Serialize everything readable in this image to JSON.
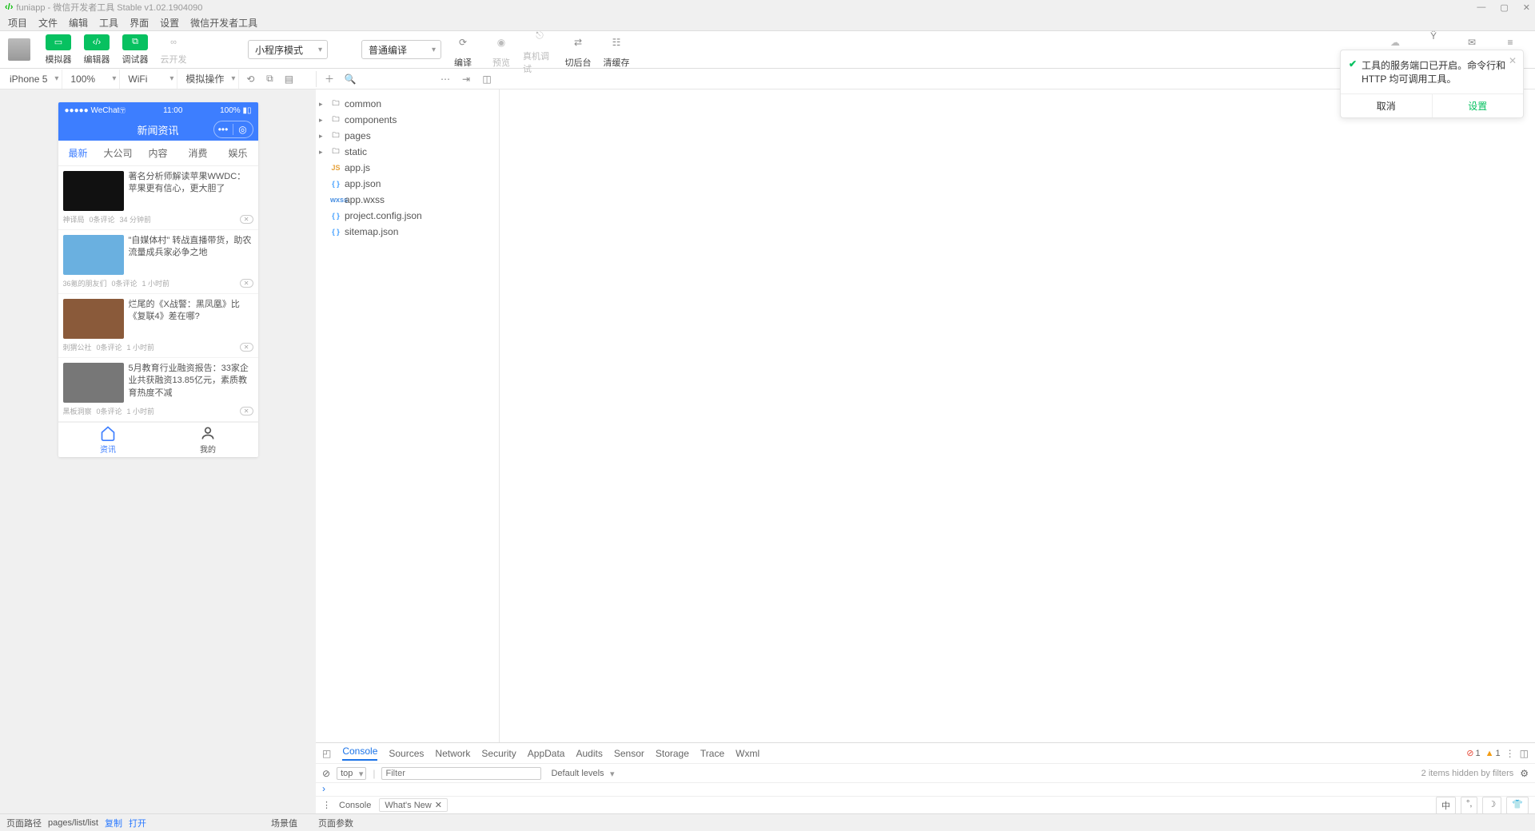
{
  "window": {
    "title": "funiapp - 微信开发者工具 Stable v1.02.1904090"
  },
  "menubar": [
    "项目",
    "文件",
    "编辑",
    "工具",
    "界面",
    "设置",
    "微信开发者工具"
  ],
  "toolbar": {
    "simulator": "模拟器",
    "editor": "编辑器",
    "debugger": "调试器",
    "cloud": "云开发",
    "mode": "小程序模式",
    "compile_opt": "普通编译",
    "compile": "编译",
    "preview": "预览",
    "remote": "真机调试",
    "background": "切后台",
    "clear": "清缓存",
    "upload": "上传",
    "version": "版本管理",
    "community": "社区",
    "detail": "详情"
  },
  "subbar": {
    "device": "iPhone 5",
    "zoom": "100%",
    "network": "WiFi",
    "mock": "模拟操作"
  },
  "sim": {
    "status_left": "●●●●● WeChat",
    "status_time": "11:00",
    "status_right": "100%",
    "nav_title": "新闻资讯",
    "tabs": [
      "最新",
      "大公司",
      "内容",
      "消费",
      "娱乐"
    ],
    "news": [
      {
        "title": "著名分析师解读苹果WWDC：苹果更有信心，更大胆了",
        "src": "神译局",
        "cm": "0条评论",
        "time": "34 分钟前"
      },
      {
        "title": "\"自媒体村\" 转战直播带货，助农流量成兵家必争之地",
        "src": "36氪的朋友们",
        "cm": "0条评论",
        "time": "1 小时前"
      },
      {
        "title": "烂尾的《X战警：黑凤凰》比《复联4》差在哪?",
        "src": "刺猬公社",
        "cm": "0条评论",
        "time": "1 小时前"
      },
      {
        "title": "5月教育行业融资报告：33家企业共获融资13.85亿元，素质教育热度不减",
        "src": "黑板洞察",
        "cm": "0条评论",
        "time": "1 小时前"
      }
    ],
    "tabbar": [
      {
        "label": "资讯"
      },
      {
        "label": "我的"
      }
    ]
  },
  "filetree": {
    "folders": [
      "common",
      "components",
      "pages",
      "static"
    ],
    "files": [
      {
        "name": "app.js",
        "k": "js"
      },
      {
        "name": "app.json",
        "k": "json"
      },
      {
        "name": "app.wxss",
        "k": "wxss"
      },
      {
        "name": "project.config.json",
        "k": "json"
      },
      {
        "name": "sitemap.json",
        "k": "json"
      }
    ]
  },
  "notification": {
    "text": "工具的服务端口已开启。命令行和 HTTP 均可调用工具。",
    "cancel": "取消",
    "settings": "设置"
  },
  "devtools": {
    "tabs": [
      "Console",
      "Sources",
      "Network",
      "Security",
      "AppData",
      "Audits",
      "Sensor",
      "Storage",
      "Trace",
      "Wxml"
    ],
    "err_count": "1",
    "warn_count": "1",
    "context": "top",
    "filter_ph": "Filter",
    "levels": "Default levels",
    "hidden": "2 items hidden by filters",
    "prompt": "›",
    "bottom_tabs": [
      "Console",
      "What's New"
    ]
  },
  "footer": {
    "path_label": "页面路径",
    "path": "pages/list/list",
    "copy": "复制",
    "open": "打开",
    "scene": "场景值",
    "params": "页面参数"
  },
  "ime": "中"
}
